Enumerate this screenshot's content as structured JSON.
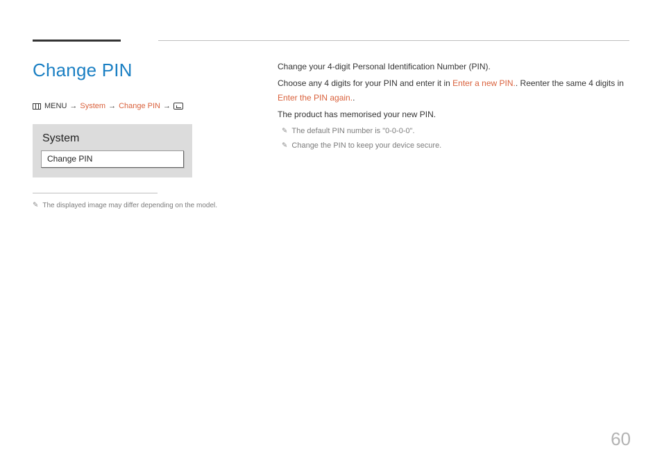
{
  "page_number": "60",
  "title": "Change PIN",
  "breadcrumb": {
    "menu_label": "MENU",
    "arrow": "→",
    "item1": "System",
    "item2": "Change PIN"
  },
  "panel": {
    "heading": "System",
    "row": "Change PIN"
  },
  "left_footnote": "The displayed image may differ depending on the model.",
  "body": {
    "p1": "Change your 4-digit Personal Identification Number (PIN).",
    "p2_a": "Choose any 4 digits for your PIN and enter it in ",
    "p2_link1": "Enter a new PIN.",
    "p2_b": ". Reenter the same 4 digits in ",
    "p2_link2": "Enter the PIN again.",
    "p2_c": ".",
    "p3": "The product has memorised your new PIN.",
    "note1": "The default PIN number is \"0-0-0-0\".",
    "note2": "Change the PIN to keep your device secure."
  }
}
